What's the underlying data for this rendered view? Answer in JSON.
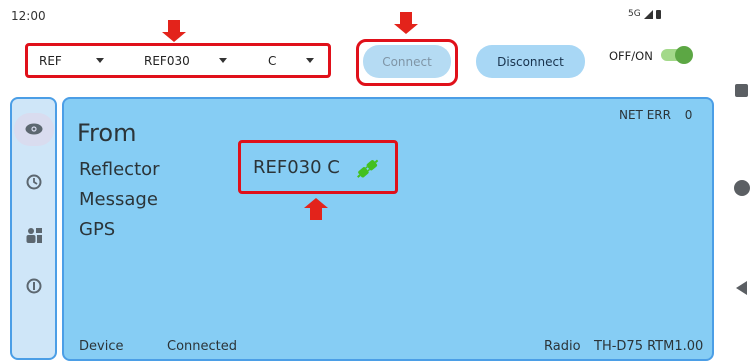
{
  "status_bar": {
    "time": "12:00",
    "network": "5G"
  },
  "toolbar": {
    "dropdown_type": "REF",
    "dropdown_reflector": "REF030",
    "dropdown_module": "C",
    "connect_label": "Connect",
    "disconnect_label": "Disconnect",
    "toggle_label": "OFF/ON",
    "toggle_state": "on"
  },
  "nav": {
    "items": [
      {
        "icon": "eye-icon",
        "selected": true
      },
      {
        "icon": "clock-icon",
        "selected": false
      },
      {
        "icon": "users-icon",
        "selected": false
      },
      {
        "icon": "info-icon",
        "selected": false
      }
    ]
  },
  "main": {
    "net_err_label": "NET ERR",
    "net_err_value": "0",
    "from_label": "From",
    "reflector_label": "Reflector",
    "reflector_value": "REF030 C",
    "message_label": "Message",
    "gps_label": "GPS",
    "device_label": "Device",
    "device_status": "Connected",
    "radio_label": "Radio",
    "radio_value": "TH-D75 RTM1.00"
  },
  "colors": {
    "panel_bg": "#86cdf4",
    "accent_border": "#4b9ee6",
    "annotation_red": "#e0101a",
    "toggle_green": "#5ca744"
  }
}
